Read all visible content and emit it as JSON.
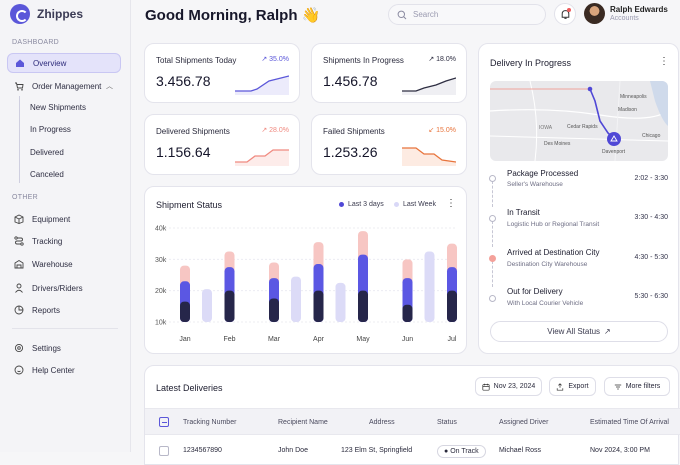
{
  "app": {
    "name": "Zhippes"
  },
  "sidebar": {
    "section_dashboard": "DASHBOARD",
    "overview": "Overview",
    "order_management": "Order Management",
    "sub_items": [
      "New Shipments",
      "In Progress",
      "Delivered",
      "Canceled"
    ],
    "section_other": "OTHER",
    "items": [
      "Equipment",
      "Tracking",
      "Warehouse",
      "Drivers/Riders",
      "Reports"
    ],
    "bottom": [
      "Settings",
      "Help Center"
    ]
  },
  "header": {
    "greeting": "Good Morning, Ralph 👋",
    "search_placeholder": "Search",
    "user_name": "Ralph Edwards",
    "user_role": "Accounts"
  },
  "kpis": [
    {
      "title": "Total Shipments Today",
      "value": "3.456.78",
      "pct": "35.0%",
      "trend": "up",
      "color": "#5b57d9"
    },
    {
      "title": "Shipments In Progress",
      "value": "1.456.78",
      "pct": "18.0%",
      "trend": "up",
      "color": "#2e2e42"
    },
    {
      "title": "Delivered Shipments",
      "value": "1.156.64",
      "pct": "28.0%",
      "trend": "up",
      "color": "#f08a80"
    },
    {
      "title": "Failed Shipments",
      "value": "1.253.26",
      "pct": "15.0%",
      "trend": "down",
      "color": "#e8743c"
    }
  ],
  "shipment_status": {
    "title": "Shipment Status",
    "legend": [
      "Last 3 days",
      "Last Week"
    ]
  },
  "chart_data": {
    "type": "bar",
    "title": "Shipment Status",
    "y_ticks": [
      "40k",
      "30k",
      "20k",
      "10k"
    ],
    "ylim": [
      10000,
      40000
    ],
    "categories": [
      "Jan",
      "Feb",
      "Mar",
      "Apr",
      "May",
      "Jun",
      "Jul"
    ],
    "series": [
      {
        "name": "Last 3 days",
        "stacks": [
          {
            "month": "Jan",
            "dark": 16500,
            "mid": 23000,
            "light": 28000
          },
          {
            "month": "Feb",
            "dark": 20000,
            "mid": 27500,
            "light": 32500
          },
          {
            "month": "Mar",
            "dark": 17500,
            "mid": 24000,
            "light": 29000
          },
          {
            "month": "Apr",
            "dark": 20000,
            "mid": 28500,
            "light": 35500
          },
          {
            "month": "May",
            "dark": 20000,
            "mid": 31500,
            "light": 39000
          },
          {
            "month": "Jun",
            "dark": 15500,
            "mid": 24000,
            "light": 30000
          },
          {
            "month": "Jul",
            "dark": 20000,
            "mid": 27500,
            "light": 35000
          }
        ]
      },
      {
        "name": "Last Week",
        "values": [
          20500,
          null,
          24500,
          22500,
          null,
          32500,
          23000
        ]
      }
    ]
  },
  "delivery": {
    "title": "Delivery In Progress",
    "map_labels": [
      "Minneapolis",
      "Madison",
      "Cedar Rapids",
      "IOWA",
      "Des Moines",
      "Chicago",
      "Davenport"
    ],
    "steps": [
      {
        "title": "Package Processed",
        "sub": "Seller's Warehouse",
        "time": "2:02 - 3:30"
      },
      {
        "title": "In Transit",
        "sub": "Logistic Hub or Regional Transit",
        "time": "3:30 - 4:30"
      },
      {
        "title": "Arrived at Destination City",
        "sub": "Destination City Warehouse",
        "time": "4:30 - 5:30"
      },
      {
        "title": "Out for Delivery",
        "sub": "With Local Courier Vehicle",
        "time": "5:30 - 6:30"
      }
    ],
    "view_all": "View All Status"
  },
  "latest": {
    "title": "Latest Deliveries",
    "date": "Nov 23, 2024",
    "export": "Export",
    "filters": "More filters",
    "columns": [
      "Tracking Number",
      "Recipient Name",
      "Address",
      "Status",
      "Assigned Driver",
      "Estimated Time Of Arrival"
    ],
    "row": [
      "1234567890",
      "John Doe",
      "123 Elm St, Springfield",
      "On Track",
      "Michael Ross",
      "Nov 2024, 3:00 PM"
    ]
  }
}
